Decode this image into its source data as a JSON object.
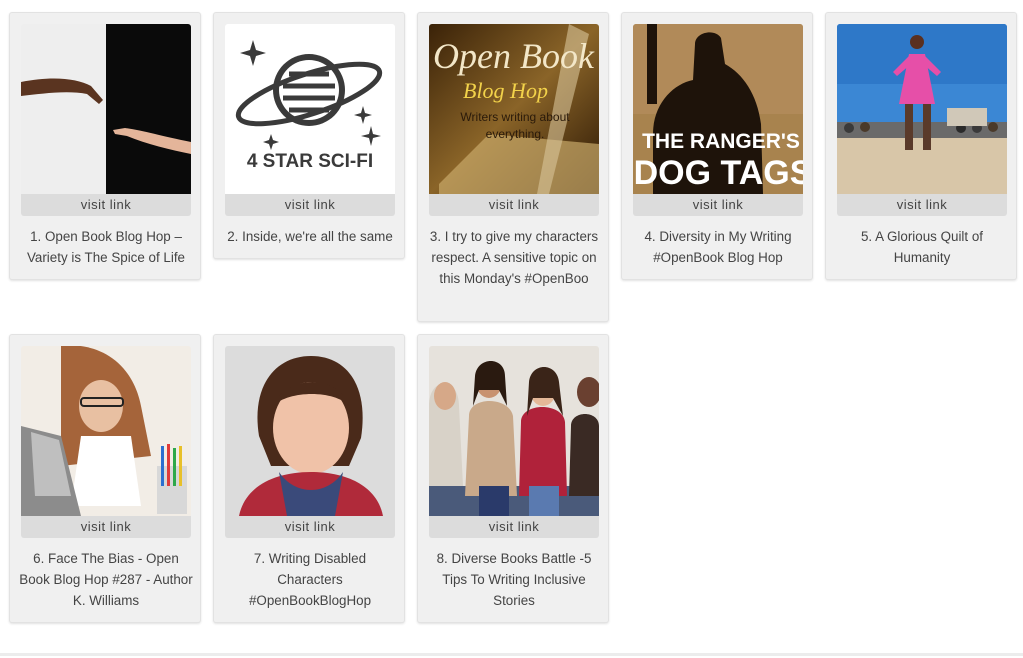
{
  "visit_label": "visit link",
  "entries": [
    {
      "title": "1. Open Book Blog Hop – Variety is The Spice of Life"
    },
    {
      "title": "2. Inside, we're all the same",
      "image_text": "4 STAR SCI-FI"
    },
    {
      "title": "3. I try to give my characters respect. A sensitive topic on this Monday's #OpenBoo",
      "image_text_1": "Open Book",
      "image_text_2": "Blog Hop",
      "image_text_3": "Writers writing about",
      "image_text_4": "everything."
    },
    {
      "title": "4. Diversity in My Writing #OpenBook Blog Hop",
      "image_text_1": "THE RANGER'S",
      "image_text_2": "DOG TAGS"
    },
    {
      "title": "5. A Glorious Quilt of Humanity"
    },
    {
      "title": "6. Face The Bias - Open Book Blog Hop #287 - Author K. Williams"
    },
    {
      "title": "7. Writing Disabled Characters #OpenBookBlogHop"
    },
    {
      "title": "8. Diverse Books Battle -5 Tips To Writing Inclusive Stories"
    }
  ]
}
